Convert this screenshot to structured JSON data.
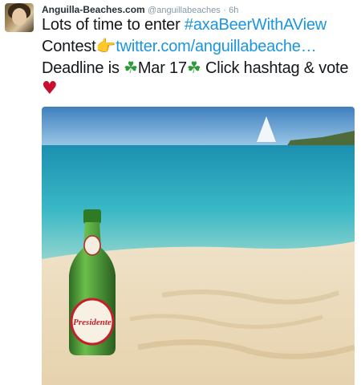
{
  "tweet": {
    "author_name": "Anguilla-Beaches.com",
    "author_handle": "@anguillabeaches",
    "separator": "·",
    "time": "6h",
    "text": {
      "part1": "Lots of time to enter ",
      "hashtag": "#axaBeerWithAView",
      "part2": "Contest",
      "pointer_emoji": "👉",
      "link": "twitter.com/anguillabeache…",
      "part3": "Deadline is ",
      "shamrock": "☘",
      "date": "Mar 17",
      "part4": " Click hashtag & vote ",
      "heart": "♥"
    },
    "photo": {
      "bottle_label": "Presidente",
      "colors": {
        "sky": "#7fb3dc",
        "sea": "#2fb3c4",
        "sand": "#eadbc0",
        "bottle": "#4f9a3a"
      }
    }
  }
}
